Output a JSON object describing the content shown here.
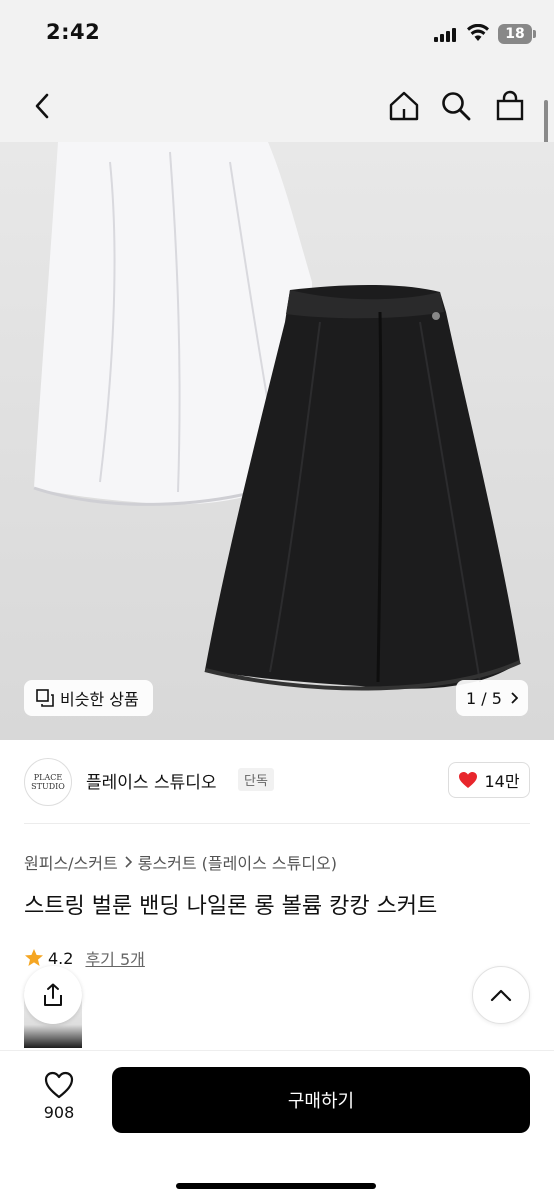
{
  "status_bar": {
    "time": "2:42",
    "battery": "18"
  },
  "nav": {
    "back_icon": "chevron-left-icon",
    "home_icon": "home-icon",
    "search_icon": "search-icon",
    "bag_icon": "shopping-bag-icon"
  },
  "gallery": {
    "similar_label": "비슷한 상품",
    "page": "1 / 5",
    "current_page": 1,
    "total_pages": 5
  },
  "brand": {
    "logo_text": "PLACE STUDIO",
    "name": "플레이스 스튜디오",
    "tag": "단독",
    "likes": "14만"
  },
  "product": {
    "breadcrumb": [
      "원피스/스커트",
      "롱스커트 (플레이스 스튜디오)"
    ],
    "title": "스트링 벌룬 밴딩 나일론 롱 볼륨 캉캉 스커트",
    "rating": "4.2",
    "review_label": "후기 5개"
  },
  "bottom": {
    "wish_count": "908",
    "buy_label": "구매하기"
  },
  "colors": {
    "accent": "#000000",
    "heart": "#e8262c",
    "star": "#f5a623"
  }
}
